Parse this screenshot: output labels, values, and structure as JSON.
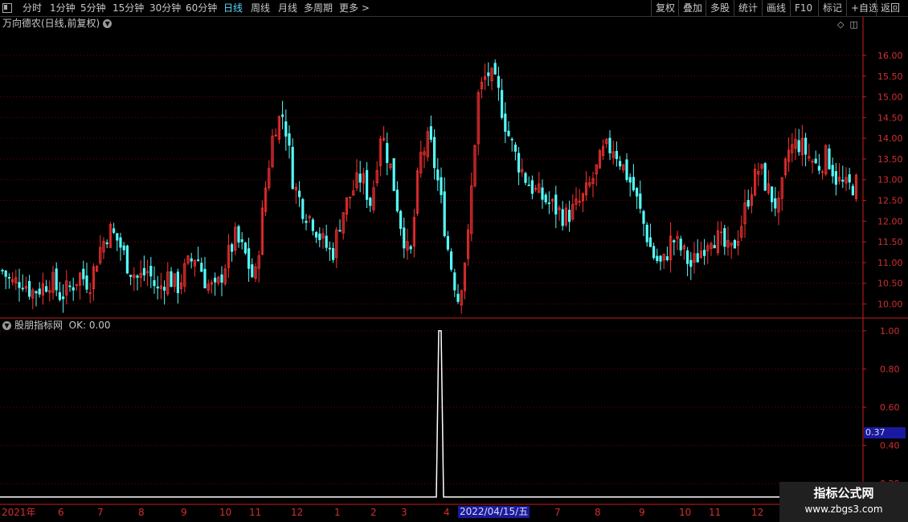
{
  "toolbar": {
    "left_items": [
      {
        "label": "分时",
        "active": false
      },
      {
        "label": "1分钟",
        "active": false
      },
      {
        "label": "5分钟",
        "active": false
      },
      {
        "label": "15分钟",
        "active": false
      },
      {
        "label": "30分钟",
        "active": false
      },
      {
        "label": "60分钟",
        "active": false
      },
      {
        "label": "日线",
        "active": true
      },
      {
        "label": "周线",
        "active": false
      },
      {
        "label": "月线",
        "active": false
      },
      {
        "label": "多周期",
        "active": false
      },
      {
        "label": "更多 >",
        "active": false
      }
    ],
    "right_items": [
      "复权",
      "叠加",
      "多股",
      "统计",
      "画线",
      "F10",
      "标记",
      "+自选",
      "返回"
    ]
  },
  "main_panel": {
    "title": "万向德农(日线,前复权)",
    "ctrl_icons": [
      "diamond-icon",
      "split-view-icon"
    ]
  },
  "indicator_panel": {
    "title": "股朋指标网",
    "ok_label": "OK: 0.00",
    "current_value": "0.37"
  },
  "x_axis": {
    "labels": [
      "2021年",
      "6",
      "7",
      "8",
      "9",
      "10",
      "11",
      "12",
      "1",
      "2",
      "3",
      "4",
      "7",
      "8",
      "9",
      "10",
      "11",
      "12"
    ],
    "selected_date": "2022/04/15/五"
  },
  "watermark": {
    "title": "指标公式网",
    "url": "www.zbgs3.com"
  },
  "colors": {
    "up": "#ff3232",
    "down": "#54fcfc",
    "grid": "#7a0000",
    "axis": "#c81e1e",
    "line": "#ffffff",
    "date_box": "#1a1aa0"
  },
  "chart_data": [
    {
      "type": "candlestick",
      "title": "万向德农(日线,前复权)",
      "ylim": [
        9.7,
        16.6
      ],
      "y_ticks": [
        10.0,
        10.5,
        11.0,
        11.5,
        12.0,
        12.5,
        13.0,
        13.5,
        14.0,
        14.5,
        15.0,
        15.5,
        16.0
      ],
      "close_series": [
        10.8,
        10.5,
        10.6,
        10.3,
        10.4,
        10.6,
        10.2,
        10.4,
        10.7,
        10.5,
        11.3,
        11.8,
        11.5,
        10.9,
        10.6,
        10.8,
        10.3,
        10.7,
        10.4,
        10.9,
        11.2,
        10.5,
        10.3,
        11.0,
        11.6,
        11.2,
        10.5,
        12.6,
        14.3,
        14.6,
        12.9,
        12.3,
        12.0,
        11.5,
        11.2,
        12.2,
        12.7,
        13.1,
        12.4,
        14.2,
        13.3,
        12.0,
        11.0,
        13.5,
        14.0,
        12.8,
        11.2,
        10.1,
        11.6,
        15.0,
        15.6,
        15.2,
        14.2,
        13.5,
        13.0,
        12.7,
        12.5,
        12.3,
        12.1,
        12.3,
        12.6,
        13.1,
        13.7,
        13.8,
        13.3,
        12.8,
        12.0,
        11.2,
        10.9,
        11.6,
        11.3,
        10.9,
        11.3,
        11.7,
        11.5,
        11.2,
        11.8,
        12.7,
        13.3,
        12.7,
        12.3,
        13.7,
        13.9,
        13.6,
        13.3,
        13.6,
        13.0,
        12.8,
        12.9
      ]
    },
    {
      "type": "line",
      "title": "股朋指标网",
      "ylim": [
        0.1,
        1.05
      ],
      "y_ticks": [
        0.2,
        0.4,
        0.6,
        0.8,
        1.0
      ],
      "series": [
        {
          "name": "OK",
          "peak_value": 1.0,
          "base_value": 0.0,
          "peak_at": "2022/04/15"
        }
      ]
    }
  ]
}
